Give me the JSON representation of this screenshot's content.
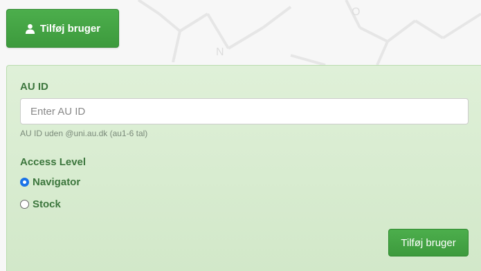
{
  "header": {
    "add_user_label": "Tilføj bruger",
    "add_user_icon": "user-icon"
  },
  "form": {
    "au_id_label": "AU ID",
    "au_id_placeholder": "Enter AU ID",
    "au_id_value": "",
    "au_id_help": "AU ID uden @uni.au.dk (au1-6 tal)",
    "access_level_label": "Access Level",
    "access_options": [
      {
        "label": "Navigator",
        "selected": true
      },
      {
        "label": "Stock",
        "selected": false
      }
    ],
    "submit_label": "Tilføj bruger"
  },
  "colors": {
    "button_green": "#449d44",
    "panel_bg": "#dff0d8",
    "label_green": "#3c763d"
  }
}
